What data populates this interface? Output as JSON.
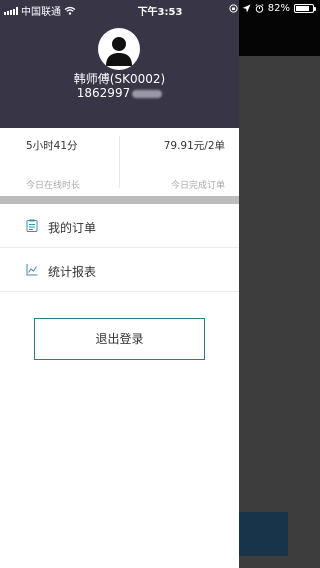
{
  "status_bar": {
    "carrier": "中国联通",
    "time": "下午3:53",
    "battery": "82%",
    "battery_level": 0.82
  },
  "profile": {
    "name": "韩师傅(SK0002)",
    "phone_visible": "1862997"
  },
  "stats": {
    "online_value": "5小时41分",
    "online_label": "今日在线时长",
    "orders_value": "79.91元/2单",
    "orders_label": "今日完成订单"
  },
  "menu": {
    "items": [
      {
        "label": "我的订单",
        "icon": "clipboard-icon"
      },
      {
        "label": "统计报表",
        "icon": "chart-icon"
      }
    ]
  },
  "logout_label": "退出登录",
  "colors": {
    "header_bg": "#383547",
    "accent": "#2e7d86",
    "overlay_bg": "#3d3d3d"
  }
}
